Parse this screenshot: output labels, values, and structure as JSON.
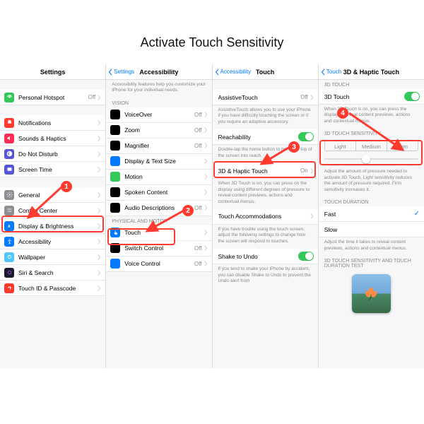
{
  "title": "Activate Touch Sensitivity",
  "panel1": {
    "header": "Settings",
    "rows": [
      {
        "label": "Personal Hotspot",
        "val": "Off",
        "icon": "#34c759"
      },
      {
        "label": "Notifications",
        "icon": "#ff3b30"
      },
      {
        "label": "Sounds & Haptics",
        "icon": "#ff2d55"
      },
      {
        "label": "Do Not Disturb",
        "icon": "#5856d6"
      },
      {
        "label": "Screen Time",
        "icon": "#5856d6"
      },
      {
        "label": "General",
        "icon": "#8e8e93"
      },
      {
        "label": "Control Center",
        "icon": "#8e8e93"
      },
      {
        "label": "Display & Brightness",
        "icon": "#007aff"
      },
      {
        "label": "Accessibility",
        "icon": "#007aff"
      },
      {
        "label": "Wallpaper",
        "icon": "#54c7fc"
      },
      {
        "label": "Siri & Search",
        "icon": "#1a1a2e"
      },
      {
        "label": "Touch ID & Passcode",
        "icon": "#ff3b30"
      }
    ]
  },
  "panel2": {
    "back": "Settings",
    "header": "Accessibility",
    "foot": "Accessibility features help you customize your iPhone for your individual needs.",
    "sec1": "VISION",
    "rows1": [
      {
        "label": "VoiceOver",
        "val": "Off",
        "icon": "#000"
      },
      {
        "label": "Zoom",
        "val": "Off",
        "icon": "#000"
      },
      {
        "label": "Magnifier",
        "val": "Off",
        "icon": "#000"
      },
      {
        "label": "Display & Text Size",
        "icon": "#007aff"
      },
      {
        "label": "Motion",
        "icon": "#34c759"
      },
      {
        "label": "Spoken Content",
        "icon": "#000"
      },
      {
        "label": "Audio Descriptions",
        "val": "Off",
        "icon": "#000"
      }
    ],
    "sec2": "PHYSICAL AND MOTOR",
    "rows2": [
      {
        "label": "Touch",
        "icon": "#007aff"
      },
      {
        "label": "Switch Control",
        "val": "Off",
        "icon": "#000"
      },
      {
        "label": "Voice Control",
        "val": "Off",
        "icon": "#007aff"
      }
    ]
  },
  "panel3": {
    "back": "Accessibility",
    "header": "Touch",
    "rows": {
      "assistive": {
        "label": "AssistiveTouch",
        "val": "Off"
      },
      "assistive_foot": "AssistiveTouch allows you to use your iPhone if you have difficulty touching the screen or if you require an adaptive accessory.",
      "reach": "Reachability",
      "reach_foot": "Double-tap the home button to bring the top of the screen into reach.",
      "haptic": {
        "label": "3D & Haptic Touch",
        "val": "On"
      },
      "haptic_foot": "When 3D Touch is on, you can press on the display using different degrees of pressure to reveal content previews, actions and contextual menus.",
      "accom": "Touch Accommodations",
      "accom_foot": "If you have trouble using the touch screen, adjust the following settings to change how the screen will respond to touches.",
      "shake": "Shake to Undo",
      "shake_foot": "If you tend to shake your iPhone by accident, you can disable Shake to Undo to prevent the Undo alert from"
    }
  },
  "panel4": {
    "back": "Touch",
    "header": "3D & Haptic Touch",
    "sec1": "3D TOUCH",
    "row1": "3D Touch",
    "foot1": "When 3D Touch is on, you can press the display to reveal content previews, actions and contextual menus.",
    "sec2": "3D TOUCH SENSITIVITY",
    "seg": [
      "Light",
      "Medium",
      "Firm"
    ],
    "foot2": "Adjust the amount of pressure needed to activate 3D Touch. Light sensitivity reduces the amount of pressure required. Firm sensitivity increases it.",
    "sec3": "TOUCH DURATION",
    "fast": "Fast",
    "slow": "Slow",
    "foot3": "Adjust the time it takes to reveal content previews, actions and contextual menus.",
    "sec4": "3D TOUCH SENSITIVITY AND TOUCH DURATION TEST"
  },
  "badges": {
    "b1": "1",
    "b2": "2",
    "b3": "3",
    "b4": "4"
  }
}
